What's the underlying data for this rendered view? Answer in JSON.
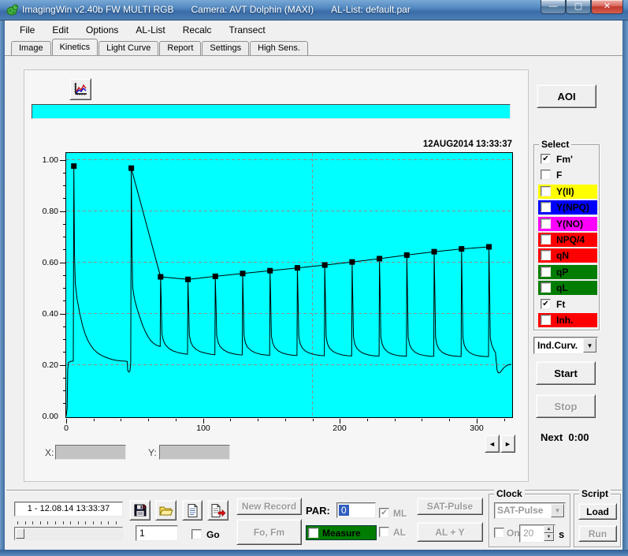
{
  "window": {
    "title_parts": [
      "ImagingWin v2.40b  FW MULTI RGB",
      "Camera: AVT Dolphin (MAXI)",
      "AL-List: default.par"
    ],
    "buttons": {
      "minimize_glyph": "—",
      "maximize_glyph": "▢",
      "close_glyph": "✕"
    }
  },
  "menu": {
    "items": [
      "File",
      "Edit",
      "Options",
      "AL-List",
      "Recalc",
      "Transect"
    ]
  },
  "tabs": {
    "items": [
      "Image",
      "Kinetics",
      "Light Curve",
      "Report",
      "Settings",
      "High Sens."
    ],
    "active": "Kinetics"
  },
  "toolbar": {
    "aoi_label": "AOI",
    "chart_icon": "kinetics-graph"
  },
  "chart_data": {
    "type": "line",
    "title": "",
    "date_label": "12AUG2014  13:33:37",
    "plot_bg": "#00ffff",
    "grid_color": "#8f8f8f",
    "x_range": [
      0,
      326
    ],
    "y_range": [
      0,
      1.03
    ],
    "x_ticks": [
      0,
      100,
      200,
      300
    ],
    "x_minor_step": 20,
    "y_ticks": [
      {
        "v": 1.0,
        "label": "1.00"
      },
      {
        "v": 0.8,
        "label": "0.80"
      },
      {
        "v": 0.6,
        "label": "0.60"
      },
      {
        "v": 0.4,
        "label": "0.40"
      },
      {
        "v": 0.2,
        "label": "0.20"
      },
      {
        "v": 0.0,
        "label": "0.00"
      }
    ],
    "y_minor_step": 0.05,
    "grid_vertical_x": [
      180
    ],
    "series": [
      {
        "name": "Fm'",
        "style": "markers-line",
        "color": "#000000",
        "line_from": 1,
        "points": [
          [
            5.6,
            0.975
          ],
          [
            47.6,
            0.967
          ],
          [
            69,
            0.543
          ],
          [
            89,
            0.533
          ],
          [
            109,
            0.545
          ],
          [
            129,
            0.556
          ],
          [
            149,
            0.567
          ],
          [
            169,
            0.578
          ],
          [
            189,
            0.589
          ],
          [
            209,
            0.601
          ],
          [
            229,
            0.614
          ],
          [
            249,
            0.628
          ],
          [
            269,
            0.641
          ],
          [
            289,
            0.652
          ],
          [
            309,
            0.66
          ]
        ]
      },
      {
        "name": "Ft",
        "style": "line",
        "color": "#000000",
        "points": [
          [
            0,
            0
          ],
          [
            0.7,
            0.03
          ],
          [
            1.1,
            0.18
          ],
          [
            1.6,
            0.208
          ],
          [
            3,
            0.213
          ],
          [
            5.2,
            0.214
          ],
          [
            5.6,
            0.975
          ],
          [
            6.1,
            0.62
          ],
          [
            6.6,
            0.52
          ],
          [
            8,
            0.455
          ],
          [
            10,
            0.398
          ],
          [
            12,
            0.352
          ],
          [
            14,
            0.318
          ],
          [
            16,
            0.293
          ],
          [
            18,
            0.275
          ],
          [
            20,
            0.261
          ],
          [
            22.5,
            0.248
          ],
          [
            25,
            0.239
          ],
          [
            28,
            0.231
          ],
          [
            31,
            0.225
          ],
          [
            34,
            0.22
          ],
          [
            37,
            0.217
          ],
          [
            40,
            0.215
          ],
          [
            43,
            0.214
          ],
          [
            44.6,
            0.213
          ],
          [
            45,
            0.178
          ],
          [
            45.8,
            0.171
          ],
          [
            46.6,
            0.176
          ],
          [
            47.2,
            0.205
          ],
          [
            47.6,
            0.967
          ],
          [
            48.2,
            0.62
          ],
          [
            48.6,
            0.5
          ],
          [
            50,
            0.455
          ],
          [
            52,
            0.415
          ],
          [
            54,
            0.382
          ],
          [
            56,
            0.352
          ],
          [
            58,
            0.328
          ],
          [
            60,
            0.308
          ],
          [
            62,
            0.293
          ],
          [
            64,
            0.283
          ],
          [
            66,
            0.276
          ],
          [
            68.7,
            0.271
          ],
          [
            69,
            0.543
          ],
          [
            69.5,
            0.44
          ],
          [
            70,
            0.32
          ],
          [
            71,
            0.295
          ],
          [
            72.5,
            0.278
          ],
          [
            75,
            0.264
          ],
          [
            78,
            0.254
          ],
          [
            82,
            0.247
          ],
          [
            86,
            0.243
          ],
          [
            88.7,
            0.241
          ],
          [
            89,
            0.533
          ],
          [
            89.5,
            0.43
          ],
          [
            90,
            0.315
          ],
          [
            91,
            0.29
          ],
          [
            92.5,
            0.273
          ],
          [
            95,
            0.26
          ],
          [
            98,
            0.251
          ],
          [
            102,
            0.245
          ],
          [
            106,
            0.241
          ],
          [
            108.7,
            0.239
          ],
          [
            109,
            0.545
          ],
          [
            109.5,
            0.44
          ],
          [
            110,
            0.315
          ],
          [
            111,
            0.288
          ],
          [
            112.5,
            0.271
          ],
          [
            115,
            0.258
          ],
          [
            118,
            0.249
          ],
          [
            122,
            0.243
          ],
          [
            126,
            0.239
          ],
          [
            128.7,
            0.238
          ],
          [
            129,
            0.556
          ],
          [
            129.5,
            0.44
          ],
          [
            130,
            0.313
          ],
          [
            131,
            0.286
          ],
          [
            132.5,
            0.269
          ],
          [
            135,
            0.256
          ],
          [
            138,
            0.247
          ],
          [
            142,
            0.241
          ],
          [
            146,
            0.238
          ],
          [
            148.7,
            0.237
          ],
          [
            149,
            0.567
          ],
          [
            149.5,
            0.45
          ],
          [
            150,
            0.312
          ],
          [
            151,
            0.284
          ],
          [
            152.5,
            0.267
          ],
          [
            155,
            0.254
          ],
          [
            158,
            0.246
          ],
          [
            162,
            0.24
          ],
          [
            166,
            0.237
          ],
          [
            168.7,
            0.236
          ],
          [
            169,
            0.578
          ],
          [
            169.5,
            0.45
          ],
          [
            170,
            0.31
          ],
          [
            171,
            0.283
          ],
          [
            172.5,
            0.266
          ],
          [
            175,
            0.253
          ],
          [
            178,
            0.245
          ],
          [
            182,
            0.239
          ],
          [
            186,
            0.236
          ],
          [
            188.7,
            0.235
          ],
          [
            189,
            0.589
          ],
          [
            189.5,
            0.46
          ],
          [
            190,
            0.31
          ],
          [
            191,
            0.282
          ],
          [
            192.5,
            0.265
          ],
          [
            195,
            0.252
          ],
          [
            198,
            0.244
          ],
          [
            202,
            0.238
          ],
          [
            206,
            0.235
          ],
          [
            208.7,
            0.234
          ],
          [
            209,
            0.601
          ],
          [
            209.5,
            0.46
          ],
          [
            210,
            0.309
          ],
          [
            211,
            0.281
          ],
          [
            212.5,
            0.264
          ],
          [
            215,
            0.251
          ],
          [
            218,
            0.243
          ],
          [
            222,
            0.237
          ],
          [
            226,
            0.234
          ],
          [
            228.7,
            0.234
          ],
          [
            229,
            0.614
          ],
          [
            229.5,
            0.47
          ],
          [
            230,
            0.308
          ],
          [
            231,
            0.28
          ],
          [
            232.5,
            0.263
          ],
          [
            235,
            0.25
          ],
          [
            238,
            0.242
          ],
          [
            242,
            0.236
          ],
          [
            246,
            0.234
          ],
          [
            248.7,
            0.233
          ],
          [
            249,
            0.628
          ],
          [
            249.5,
            0.47
          ],
          [
            250,
            0.307
          ],
          [
            251,
            0.279
          ],
          [
            252.5,
            0.262
          ],
          [
            255,
            0.249
          ],
          [
            258,
            0.241
          ],
          [
            262,
            0.236
          ],
          [
            266,
            0.233
          ],
          [
            268.7,
            0.233
          ],
          [
            269,
            0.641
          ],
          [
            269.5,
            0.48
          ],
          [
            270,
            0.306
          ],
          [
            271,
            0.278
          ],
          [
            272.5,
            0.261
          ],
          [
            275,
            0.248
          ],
          [
            278,
            0.24
          ],
          [
            282,
            0.235
          ],
          [
            286,
            0.233
          ],
          [
            288.7,
            0.232
          ],
          [
            289,
            0.652
          ],
          [
            289.5,
            0.48
          ],
          [
            290,
            0.305
          ],
          [
            291,
            0.277
          ],
          [
            292.5,
            0.26
          ],
          [
            295,
            0.247
          ],
          [
            298,
            0.239
          ],
          [
            302,
            0.234
          ],
          [
            306,
            0.232
          ],
          [
            308.7,
            0.232
          ],
          [
            309,
            0.66
          ],
          [
            309.5,
            0.48
          ],
          [
            310,
            0.305
          ],
          [
            311,
            0.278
          ],
          [
            312,
            0.265
          ],
          [
            313,
            0.255
          ],
          [
            313.8,
            0.248
          ],
          [
            314.3,
            0.215
          ],
          [
            315,
            0.178
          ],
          [
            316,
            0.168
          ],
          [
            317.2,
            0.17
          ],
          [
            318.5,
            0.179
          ],
          [
            320,
            0.189
          ],
          [
            322,
            0.197
          ],
          [
            324,
            0.201
          ],
          [
            325.5,
            0.202
          ]
        ]
      }
    ]
  },
  "xy_readout": {
    "x_label": "X:",
    "y_label": "Y:",
    "x_value": "",
    "y_value": ""
  },
  "nav": {
    "prev_glyph": "◄",
    "next_glyph": "►"
  },
  "select_panel": {
    "title": "Select",
    "items": [
      {
        "label": "Fm'",
        "checked": true,
        "bg": null
      },
      {
        "label": "F",
        "checked": false,
        "bg": null
      },
      {
        "label": "Y(II)",
        "checked": false,
        "bg": "#ffff00"
      },
      {
        "label": "Y(NPQ)",
        "checked": false,
        "bg": "#0000ff"
      },
      {
        "label": "Y(NO)",
        "checked": false,
        "bg": "#ff00ff"
      },
      {
        "label": "NPQ/4",
        "checked": false,
        "bg": "#ff0000"
      },
      {
        "label": "qN",
        "checked": false,
        "bg": "#ff0000"
      },
      {
        "label": "qP",
        "checked": false,
        "bg": "#007d00"
      },
      {
        "label": "qL",
        "checked": false,
        "bg": "#007d00"
      },
      {
        "label": "Ft",
        "checked": true,
        "bg": null
      },
      {
        "label": "Inh.",
        "checked": false,
        "bg": "#ff0000"
      }
    ]
  },
  "curve_mode": {
    "value": "Ind.Curv.",
    "arrow_glyph": "▼"
  },
  "run_controls": {
    "start": "Start",
    "stop": "Stop",
    "next_label": "Next",
    "next_value": "0:00"
  },
  "record_bar": {
    "record_field": "1 - 12.08.14 13:33:37",
    "record_number": "1",
    "go_label": "Go"
  },
  "measure_controls": {
    "new_record": "New Record",
    "fo_fm": "Fo, Fm",
    "par_label": "PAR:",
    "par_value": "0",
    "ml_label": "ML",
    "al_label": "AL",
    "measure_label": "Measure",
    "measure_bg": "#007d00",
    "sat_pulse": "SAT-Pulse",
    "al_y": "AL + Y",
    "selection_color": "#2f5fc0"
  },
  "clock": {
    "title": "Clock",
    "mode": "SAT-Pulse",
    "on_label": "On",
    "interval": "20",
    "unit": "s",
    "spin_up": "▲",
    "spin_down": "▼"
  },
  "script": {
    "title": "Script",
    "load": "Load",
    "run": "Run"
  }
}
